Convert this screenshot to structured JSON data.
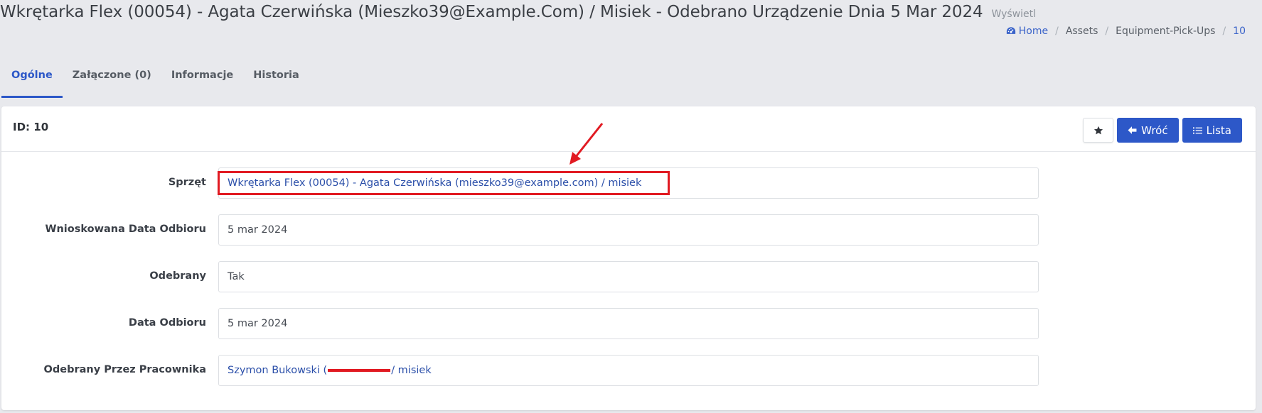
{
  "header": {
    "title": "Wkrętarka Flex (00054) - Agata Czerwińska (Mieszko39@Example.Com) / Misiek - Odebrano Urządzenie Dnia 5 Mar 2024",
    "subtitle": "Wyświetl"
  },
  "breadcrumb": {
    "items": [
      {
        "label": "Home",
        "icon": "dashboard-icon"
      },
      {
        "label": "Assets"
      },
      {
        "label": "Equipment-Pick-Ups"
      },
      {
        "label": "10"
      }
    ]
  },
  "tabs": [
    {
      "label": "Ogólne",
      "active": true
    },
    {
      "label": "Załączone (0)"
    },
    {
      "label": "Informacje"
    },
    {
      "label": "Historia"
    }
  ],
  "card": {
    "id_label": "ID: 10",
    "star_icon": "star-icon",
    "back_label": "Wróć",
    "list_label": "Lista"
  },
  "fields": [
    {
      "label": "Sprzęt",
      "value": "Wkrętarka Flex (00054) - Agata Czerwińska (mieszko39@example.com) / misiek"
    },
    {
      "label": "Wnioskowana Data Odbioru",
      "value": "5 mar 2024"
    },
    {
      "label": "Odebrany",
      "value": "Tak"
    },
    {
      "label": "Data Odbioru",
      "value": "5 mar 2024"
    },
    {
      "label": "Odebrany Przez Pracownika",
      "value_before": "Szymon Bukowski (",
      "value_after": "/ misiek"
    }
  ],
  "colors": {
    "primary": "#2d58c8",
    "annotation": "#e11a22"
  }
}
